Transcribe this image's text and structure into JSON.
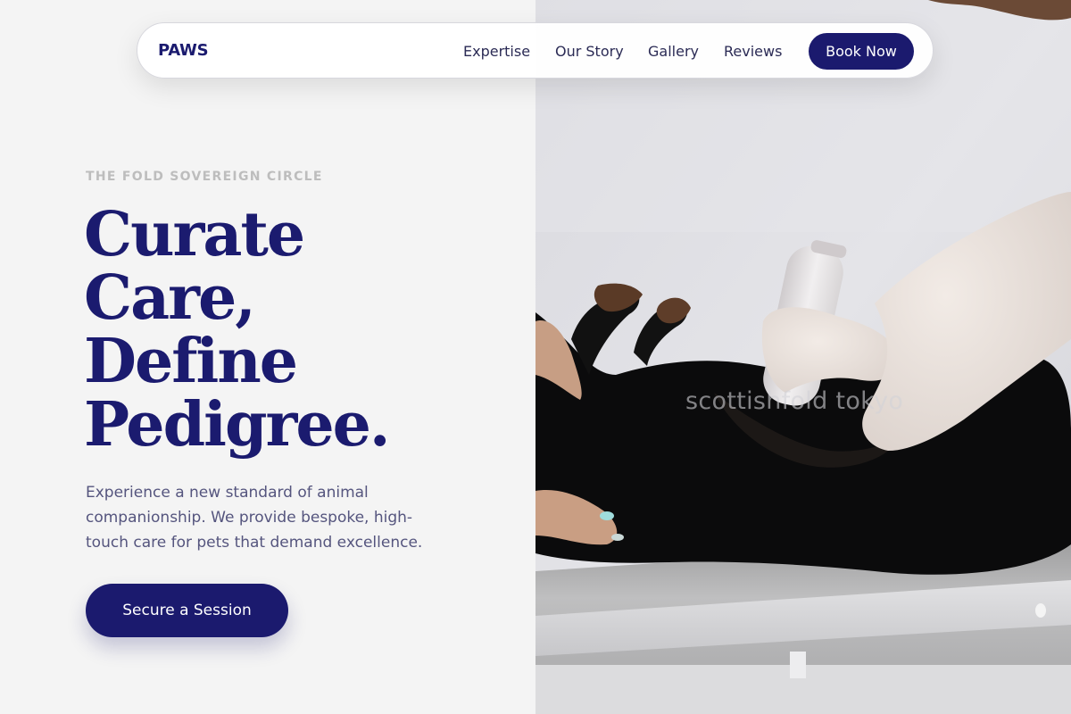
{
  "nav": {
    "brand": "PAWS",
    "links": [
      {
        "label": "Expertise"
      },
      {
        "label": "Our Story"
      },
      {
        "label": "Gallery"
      },
      {
        "label": "Reviews"
      }
    ],
    "cta_label": "Book Now"
  },
  "hero": {
    "eyebrow": "THE FOLD SOVEREIGN CIRCLE",
    "headline_lines": [
      "Curate",
      "Care,",
      "Define",
      "Pedigree."
    ],
    "lede": "Experience a new standard of animal companionship. We provide bespoke, high-touch care for pets that demand excellence.",
    "cta_label": "Secure a Session"
  },
  "photo": {
    "watermark": "scottishfold tokyo"
  },
  "colors": {
    "brand_navy": "#1b1a6e",
    "page_background": "#f4f4f4",
    "eyebrow_gray": "#bdbdbd",
    "body_text": "#55557e"
  }
}
